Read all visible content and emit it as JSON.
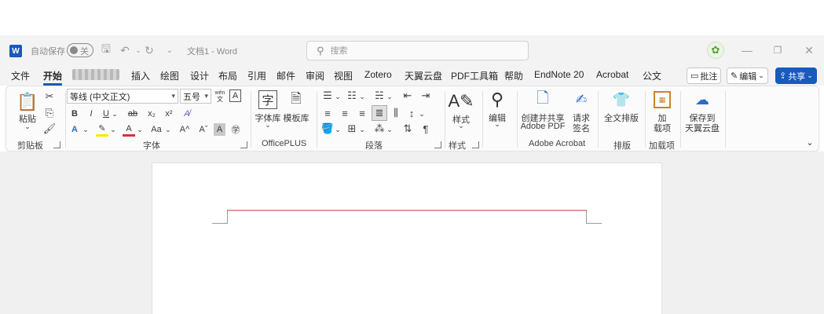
{
  "titlebar": {
    "autosave_label": "自动保存",
    "autosave_state": "关",
    "doc_title": "文档1 - Word",
    "search_placeholder": "搜索"
  },
  "tabs": [
    "文件",
    "开始",
    "插入",
    "绘图",
    "设计",
    "布局",
    "引用",
    "邮件",
    "审阅",
    "视图",
    "Zotero",
    "天翼云盘",
    "PDF工具箱",
    "帮助",
    "EndNote 20",
    "Acrobat",
    "公文"
  ],
  "tab_buttons": {
    "comment": "批注",
    "edit": "编辑",
    "share": "共享"
  },
  "ribbon": {
    "clipboard": {
      "paste": "粘贴",
      "label": "剪贴板"
    },
    "font": {
      "name": "等线 (中文正文)",
      "size": "五号",
      "label": "字体",
      "pinyin": "wén"
    },
    "officeplus": {
      "font_lib": "字体库",
      "template_lib": "模板库",
      "label": "OfficePLUS"
    },
    "paragraph": {
      "label": "段落"
    },
    "styles": {
      "button": "样式",
      "label": "样式"
    },
    "editing": {
      "button": "编辑"
    },
    "adobe": {
      "create_line1": "创建并共享",
      "create_line2": "Adobe PDF",
      "request_line1": "请求",
      "request_line2": "签名",
      "label": "Adobe Acrobat"
    },
    "layout": {
      "button": "全文排版",
      "label": "排版"
    },
    "addins": {
      "button_line1": "加",
      "button_line2": "载项",
      "label": "加载项"
    },
    "tianyi": {
      "line1": "保存到",
      "line2": "天翼云盘"
    }
  },
  "colors": {
    "accent": "#185abd",
    "header_line": "#e39a9a"
  }
}
